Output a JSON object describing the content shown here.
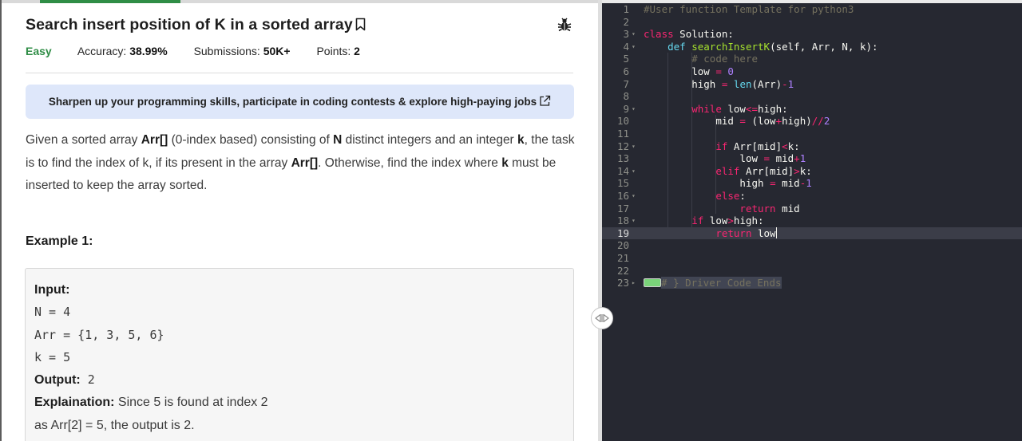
{
  "problem": {
    "title": "Search insert position of K in a sorted array",
    "difficulty": "Easy",
    "accuracy_label": "Accuracy:",
    "accuracy_value": "38.99%",
    "submissions_label": "Submissions:",
    "submissions_value": "50K+",
    "points_label": "Points:",
    "points_value": "2"
  },
  "banner": {
    "text": "Sharpen up your programming skills, participate in coding contests & explore high-paying jobs"
  },
  "description": {
    "p1_a": "Given a sorted array ",
    "p1_arr": "Arr[]",
    "p1_b": " (0-index based) consisting of ",
    "p1_n": "N",
    "p1_c": " distinct integers and an integer ",
    "p1_k": "k",
    "p1_d": ", the task is to find the index of k, if its present in the array ",
    "p1_arr2": "Arr[]",
    "p1_e": ". Otherwise, find the index where ",
    "p1_k2": "k",
    "p1_f": " must be inserted to keep the array sorted."
  },
  "example": {
    "heading": "Example 1:",
    "input_label": "Input:",
    "line_n": "N = 4",
    "line_arr": "Arr = {1, 3, 5, 6}",
    "line_k": "k = 5",
    "output_label": "Output:",
    "output_value": " 2",
    "explanation_label": "Explaination:",
    "explanation_1": " Since 5 is found at index 2",
    "explanation_2": "as Arr[2] = 5, the output is 2."
  },
  "editor": {
    "active_line": 19,
    "lines": [
      {
        "n": "1",
        "fold": ""
      },
      {
        "n": "2",
        "fold": ""
      },
      {
        "n": "3",
        "fold": "▾"
      },
      {
        "n": "4",
        "fold": "▾"
      },
      {
        "n": "5",
        "fold": ""
      },
      {
        "n": "6",
        "fold": ""
      },
      {
        "n": "7",
        "fold": ""
      },
      {
        "n": "8",
        "fold": ""
      },
      {
        "n": "9",
        "fold": "▾"
      },
      {
        "n": "10",
        "fold": ""
      },
      {
        "n": "11",
        "fold": ""
      },
      {
        "n": "12",
        "fold": "▾"
      },
      {
        "n": "13",
        "fold": ""
      },
      {
        "n": "14",
        "fold": "▾"
      },
      {
        "n": "15",
        "fold": ""
      },
      {
        "n": "16",
        "fold": "▾"
      },
      {
        "n": "17",
        "fold": ""
      },
      {
        "n": "18",
        "fold": "▾"
      },
      {
        "n": "19",
        "fold": ""
      },
      {
        "n": "20",
        "fold": ""
      },
      {
        "n": "21",
        "fold": ""
      },
      {
        "n": "22",
        "fold": ""
      },
      {
        "n": "23",
        "fold": "▸"
      }
    ],
    "code": {
      "l1": "#User function Template for python3",
      "l3_kw": "class",
      "l3_rest": " Solution:",
      "l4_kw": "def",
      "l4_fn": "searchInsertK",
      "l4_rest": "(self, Arr, N, k):",
      "l5": "# code here",
      "l6_a": "low ",
      "l6_op": "=",
      "l6_num": " 0",
      "l7_a": "high ",
      "l7_op": "=",
      "l7_bi": " len",
      "l7_b": "(Arr)",
      "l7_op2": "-",
      "l7_num": "1",
      "l9_kw": "while",
      "l9_a": " low",
      "l9_op": "<=",
      "l9_b": "high:",
      "l10_a": "mid ",
      "l10_op": "=",
      "l10_b": " (low",
      "l10_op2": "+",
      "l10_c": "high)",
      "l10_op3": "//",
      "l10_num": "2",
      "l12_kw": "if",
      "l12_a": " Arr[mid]",
      "l12_op": "<",
      "l12_b": "k:",
      "l13_a": "low ",
      "l13_op": "=",
      "l13_b": " mid",
      "l13_op2": "+",
      "l13_num": "1",
      "l14_kw": "elif",
      "l14_a": " Arr[mid]",
      "l14_op": ">",
      "l14_b": "k:",
      "l15_a": "high ",
      "l15_op": "=",
      "l15_b": " mid",
      "l15_op2": "-",
      "l15_num": "1",
      "l16_kw": "else",
      "l16_b": ":",
      "l17_kw": "return",
      "l17_b": " mid",
      "l18_kw": "if",
      "l18_a": " low",
      "l18_op": ">",
      "l18_b": "high:",
      "l19_kw": "return",
      "l19_b": " low",
      "l23": "# } Driver Code Ends"
    }
  },
  "colors": {
    "accent_green": "#2f8d46",
    "banner_bg": "#dee7fa",
    "editor_bg": "#262831"
  }
}
